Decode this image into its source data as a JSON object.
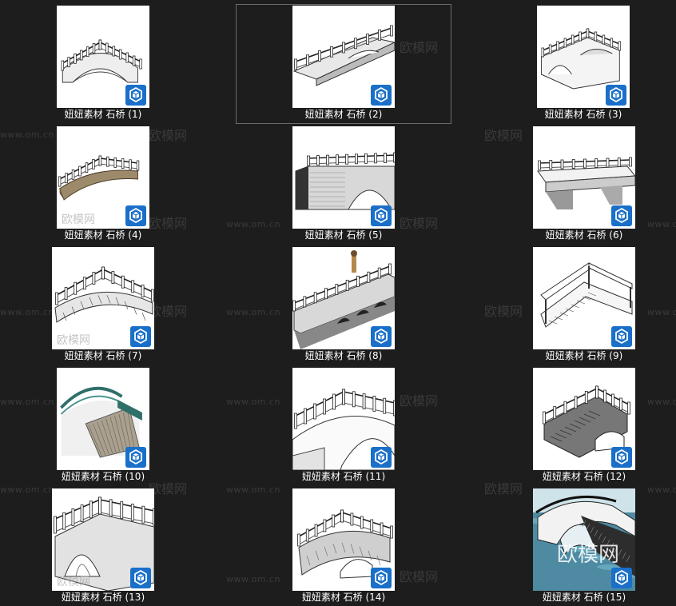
{
  "watermark": {
    "url": "www.om.cn",
    "brand": "欧模网"
  },
  "items": [
    {
      "caption": "妞妞素材 石桥 (1)",
      "icon": "sketchup-icon"
    },
    {
      "caption": "妞妞素材 石桥 (2)",
      "icon": "sketchup-icon"
    },
    {
      "caption": "妞妞素材 石桥 (3)",
      "icon": "sketchup-icon"
    },
    {
      "caption": "妞妞素材 石桥 (4)",
      "icon": "sketchup-icon"
    },
    {
      "caption": "妞妞素材 石桥 (5)",
      "icon": "sketchup-icon"
    },
    {
      "caption": "妞妞素材 石桥 (6)",
      "icon": "sketchup-icon"
    },
    {
      "caption": "妞妞素材 石桥 (7)",
      "icon": "sketchup-icon"
    },
    {
      "caption": "妞妞素材 石桥 (8)",
      "icon": "sketchup-icon"
    },
    {
      "caption": "妞妞素材 石桥 (9)",
      "icon": "sketchup-icon"
    },
    {
      "caption": "妞妞素材 石桥 (10)",
      "icon": "sketchup-icon"
    },
    {
      "caption": "妞妞素材 石桥 (11)",
      "icon": "sketchup-icon"
    },
    {
      "caption": "妞妞素材 石桥 (12)",
      "icon": "sketchup-icon"
    },
    {
      "caption": "妞妞素材 石桥 (13)",
      "icon": "sketchup-icon"
    },
    {
      "caption": "妞妞素材 石桥 (14)",
      "icon": "sketchup-icon"
    },
    {
      "caption": "妞妞素材 石桥 (15)",
      "icon": "sketchup-icon"
    }
  ],
  "selected_index": 1,
  "colors": {
    "background": "#1d1d1d",
    "badge": "#1a6fc9",
    "selection_border": "#6b6b6b"
  }
}
